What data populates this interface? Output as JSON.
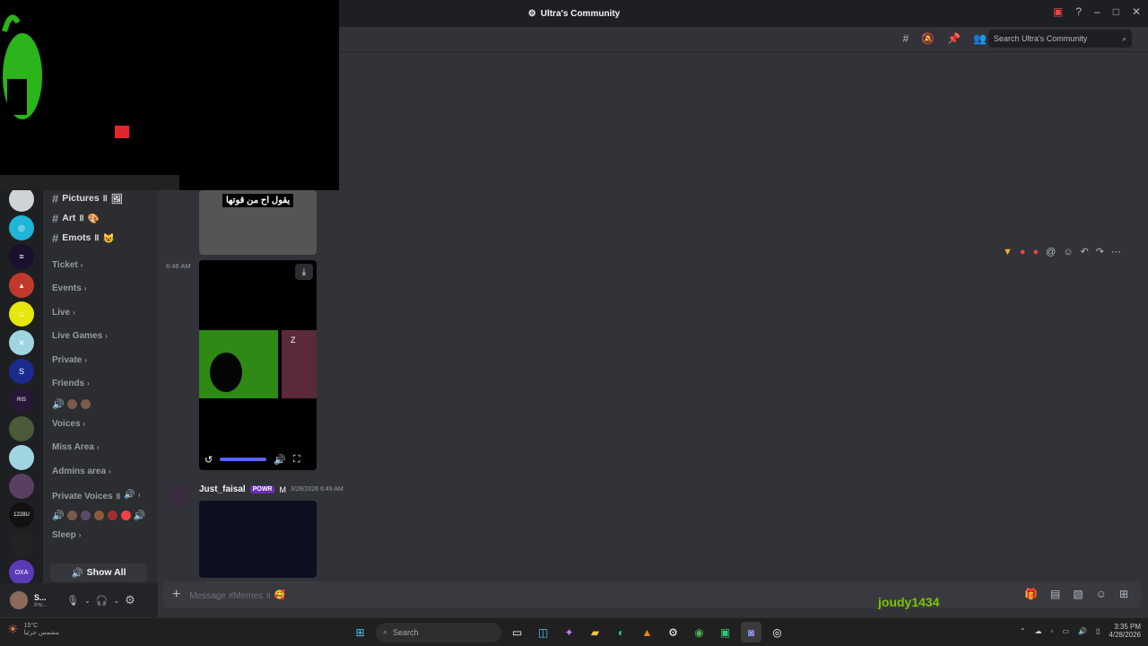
{
  "window": {
    "title": "Ultra's Community"
  },
  "header": {
    "search_placeholder": "Search Ultra's Community"
  },
  "channels": {
    "text": [
      {
        "label": "Pictures ॥",
        "emoji": "🖼"
      },
      {
        "label": "Art ॥",
        "emoji": "🎨"
      },
      {
        "label": "Emots ॥",
        "emoji": "😺"
      }
    ],
    "categories": [
      {
        "label": "Ticket"
      },
      {
        "label": "Events"
      },
      {
        "label": "Live"
      },
      {
        "label": "Live Games"
      },
      {
        "label": "Private"
      },
      {
        "label": "Friends"
      },
      {
        "label": "Voices"
      },
      {
        "label": "Miss Area"
      },
      {
        "label": "Admins area"
      },
      {
        "label": "Private Voices ॥"
      },
      {
        "label": "Sleep"
      }
    ],
    "show_all": "Show All"
  },
  "user_panel": {
    "name": "S...",
    "status": "Inv..."
  },
  "messages": {
    "caption": "يقول اح من قوتها",
    "time": "6:48 AM",
    "author": "Just_faisal",
    "author_tag": "POWR",
    "timestamp": "3/28/2026 6:49 AM"
  },
  "composer": {
    "placeholder": "Message #Memes ॥",
    "emoji": "🥰"
  },
  "stream_overlay": {
    "streamer": "joudy1434"
  },
  "taskbar": {
    "search": "Search",
    "weather_temp": "15°C",
    "weather_desc": "مشمس جزئيا",
    "clock_time": "3:35 PM",
    "clock_date": "4/28/2026"
  },
  "colors": {
    "accent": "#5865f2",
    "background": "#313338",
    "sidebar": "#2b2d31"
  }
}
